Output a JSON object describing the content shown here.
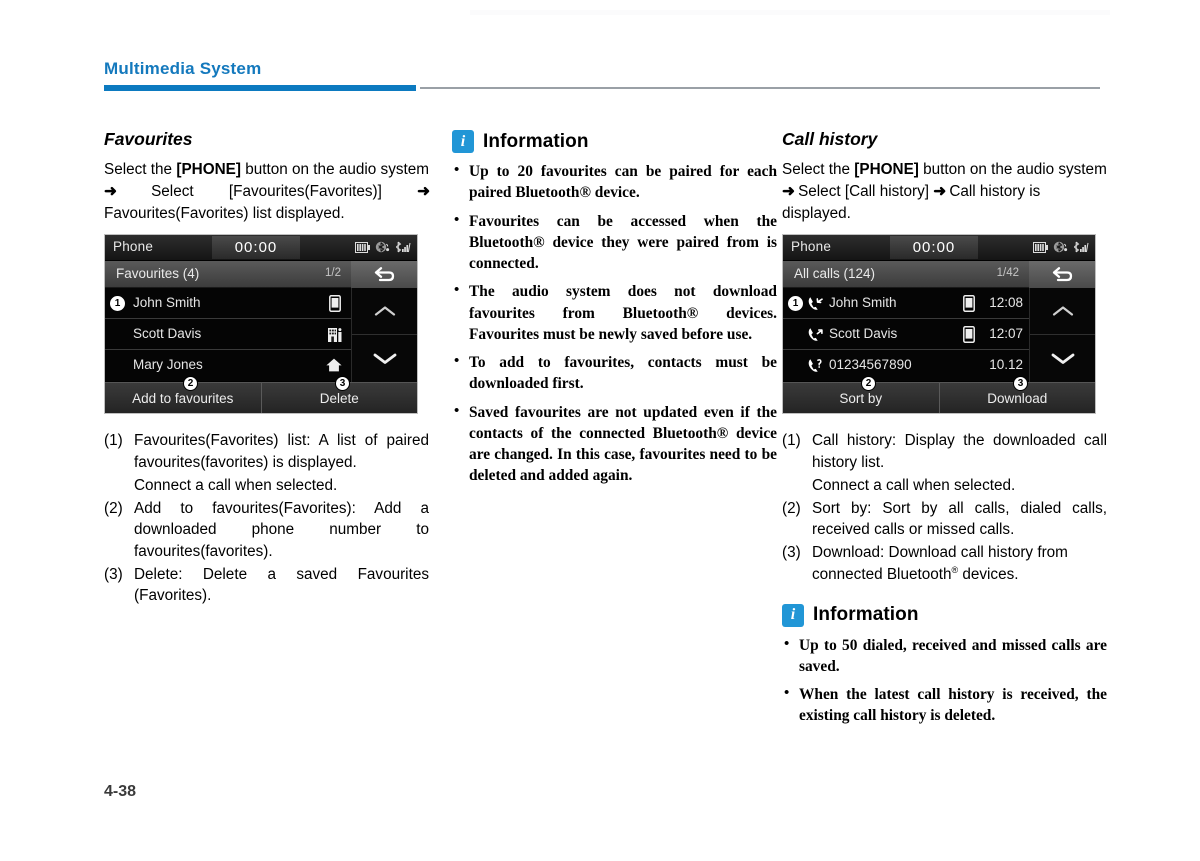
{
  "header": {
    "chapter_title": "Multimedia System",
    "accent_color": "#0c7ac0"
  },
  "page_number": "4-38",
  "col1": {
    "section_title": "Favourites",
    "intro_part1": "Select the ",
    "intro_bold": "[PHONE]",
    "intro_part2": " button on the audio system ",
    "intro_arrow1": "➜",
    "intro_part3": " Select [Favourites(Favorites)] ",
    "intro_arrow2": "➜",
    "intro_part4": " Favourites(Favorites) list displayed.",
    "device": {
      "status_label": "Phone",
      "clock": "00:00",
      "title": "Favourites (4)",
      "page_indicator": "1/2",
      "back_icon": "back-arrow-icon",
      "rows": [
        {
          "index": "1",
          "name": "John Smith",
          "icon": "mobile-phone-icon",
          "time": ""
        },
        {
          "index": "",
          "name": "Scott Davis",
          "icon": "office-building-icon",
          "time": ""
        },
        {
          "index": "",
          "name": "Mary Jones",
          "icon": "home-icon",
          "time": ""
        }
      ],
      "scroll_up_icon": "chevron-up-icon",
      "scroll_down_icon": "chevron-down-icon",
      "footer_buttons": [
        {
          "label": "Add to favourites",
          "callout": "2"
        },
        {
          "label": "Delete",
          "callout": "3"
        }
      ],
      "system_icons": [
        "battery-icon",
        "bluetooth-audio-icon",
        "bluetooth-signal-icon"
      ]
    },
    "list": [
      {
        "marker": "(1)",
        "text": "Favourites(Favorites) list: A list of paired favourites(favorites) is displayed.",
        "sub": "Connect a call when selected."
      },
      {
        "marker": "(2)",
        "text": "Add to favourites(Favorites): Add a downloaded phone number to favourites(favorites)."
      },
      {
        "marker": "(3)",
        "text": "Delete: Delete a saved Favourites (Favorites)."
      }
    ]
  },
  "col2": {
    "info_title": "Information",
    "info_icon": "info-icon",
    "items": [
      "Up to 20 favourites can be paired for each paired Bluetooth® device.",
      "Favourites can be accessed when the Bluetooth® device they were paired from is connected.",
      "The audio system does not download favourites from Bluetooth® devices. Favourites must be newly saved before use.",
      "To add to favourites, contacts must be downloaded first.",
      "Saved favourites are not updated even if the contacts of the connected Bluetooth® device are changed. In this case, favourites need to be deleted and added again."
    ]
  },
  "col3": {
    "section_title": "Call history",
    "intro_part1": "Select the ",
    "intro_bold": "[PHONE]",
    "intro_part2": " button on the audio system ",
    "intro_arrow1": "➜",
    "intro_part3": " Select [Call history] ",
    "intro_arrow2": "➜",
    "intro_part4": " Call history is displayed.",
    "device": {
      "status_label": "Phone",
      "clock": "00:00",
      "title": "All calls (124)",
      "page_indicator": "1/42",
      "back_icon": "back-arrow-icon",
      "rows": [
        {
          "index": "1",
          "name": "John Smith",
          "call_icon": "incoming-call-icon",
          "icon": "mobile-phone-icon",
          "time": "12:08"
        },
        {
          "index": "",
          "name": "Scott Davis",
          "call_icon": "outgoing-call-icon",
          "icon": "mobile-phone-icon",
          "time": "12:07"
        },
        {
          "index": "",
          "name": "01234567890",
          "call_icon": "missed-call-icon",
          "icon": "",
          "time": "10.12"
        }
      ],
      "scroll_up_icon": "chevron-up-icon",
      "scroll_down_icon": "chevron-down-icon",
      "footer_buttons": [
        {
          "label": "Sort by",
          "callout": "2"
        },
        {
          "label": "Download",
          "callout": "3"
        }
      ],
      "system_icons": [
        "battery-icon",
        "bluetooth-audio-icon",
        "bluetooth-signal-icon"
      ]
    },
    "list": [
      {
        "marker": "(1)",
        "text": "Call history: Display the downloaded call history list.",
        "sub": "Connect a call when selected."
      },
      {
        "marker": "(2)",
        "text": "Sort by: Sort by all calls, dialed calls, received calls or missed calls."
      },
      {
        "marker": "(3)",
        "text_pre": "Download: Download call history from connected Bluetooth",
        "text_sup": "®",
        "text_post": " devices."
      }
    ],
    "info_title": "Information",
    "info_icon": "info-icon",
    "info_items": [
      "Up to 50 dialed, received and missed calls are saved.",
      "When the latest call history is received, the existing call history is deleted."
    ]
  }
}
